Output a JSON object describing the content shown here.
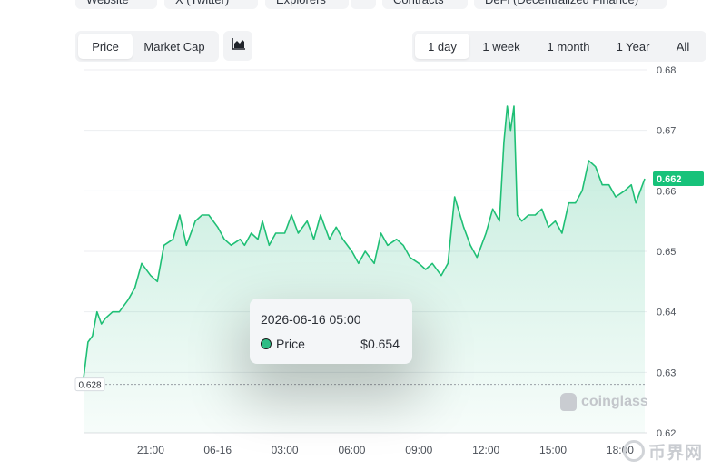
{
  "top_links": [
    "Website",
    "X (Twitter)",
    "Explorers",
    "",
    "Contracts",
    "DeFi (Decentralized Finance)"
  ],
  "metric_tabs": [
    "Price",
    "Market Cap"
  ],
  "active_metric": "Price",
  "range_tabs": [
    "1 day",
    "1 week",
    "1 month",
    "1 Year",
    "All"
  ],
  "active_range": "1 day",
  "chart_icon": "area-chart-icon",
  "colors": {
    "line": "#1fbf75",
    "fill": "#2ebd85",
    "badge": "#17c27a",
    "tooltip_dot": "#2ebd85"
  },
  "tooltip": {
    "date": "2026-06-16 05:00",
    "series": "Price",
    "value": "$0.654"
  },
  "watermark": "coinglass",
  "corner_logo": "币界网",
  "chart_data": {
    "type": "area",
    "series": [
      {
        "name": "Price"
      }
    ],
    "ylim": [
      0.62,
      0.68
    ],
    "y_ticks": [
      "0.68",
      "0.67",
      "0.66",
      "0.65",
      "0.64",
      "0.63",
      "0.62"
    ],
    "x_ticks": [
      "21:00",
      "06-16",
      "03:00",
      "06:00",
      "09:00",
      "12:00",
      "15:00",
      "18:00"
    ],
    "x_tick_hours": [
      3,
      6,
      9,
      12,
      15,
      18,
      21,
      24
    ],
    "hours": [
      0,
      0.2,
      0.4,
      0.6,
      0.8,
      1.0,
      1.3,
      1.6,
      2.0,
      2.3,
      2.6,
      3.0,
      3.3,
      3.6,
      4.0,
      4.3,
      4.6,
      5.0,
      5.3,
      5.6,
      6.0,
      6.3,
      6.6,
      7.0,
      7.2,
      7.5,
      7.8,
      8.0,
      8.3,
      8.6,
      9.0,
      9.3,
      9.6,
      10.0,
      10.3,
      10.6,
      11.0,
      11.3,
      11.6,
      12.0,
      12.3,
      12.6,
      13.0,
      13.3,
      13.6,
      14.0,
      14.3,
      14.6,
      15.0,
      15.3,
      15.6,
      16.0,
      16.3,
      16.6,
      17.0,
      17.3,
      17.6,
      18.0,
      18.3,
      18.6,
      18.8,
      18.95,
      19.1,
      19.25,
      19.4,
      19.6,
      19.9,
      20.2,
      20.5,
      20.8,
      21.1,
      21.4,
      21.7,
      22.0,
      22.3,
      22.6,
      22.9,
      23.2,
      23.5,
      23.8,
      24.2,
      24.5,
      24.7,
      24.9,
      25.1
    ],
    "values": [
      0.629,
      0.635,
      0.636,
      0.64,
      0.638,
      0.639,
      0.64,
      0.64,
      0.642,
      0.644,
      0.648,
      0.646,
      0.645,
      0.651,
      0.652,
      0.656,
      0.651,
      0.655,
      0.656,
      0.656,
      0.654,
      0.652,
      0.651,
      0.652,
      0.651,
      0.653,
      0.652,
      0.655,
      0.651,
      0.653,
      0.653,
      0.656,
      0.653,
      0.655,
      0.652,
      0.656,
      0.652,
      0.654,
      0.652,
      0.65,
      0.648,
      0.65,
      0.648,
      0.653,
      0.651,
      0.652,
      0.651,
      0.649,
      0.648,
      0.647,
      0.648,
      0.646,
      0.648,
      0.659,
      0.654,
      0.651,
      0.649,
      0.653,
      0.657,
      0.655,
      0.668,
      0.674,
      0.67,
      0.674,
      0.656,
      0.655,
      0.656,
      0.656,
      0.657,
      0.654,
      0.655,
      0.653,
      0.658,
      0.658,
      0.66,
      0.665,
      0.664,
      0.661,
      0.661,
      0.659,
      0.66,
      0.661,
      0.658,
      0.66,
      0.662
    ],
    "last_value_label": "0.662",
    "baseline_label": "0.628",
    "baseline_value": 0.628,
    "hover_hour": 8.0,
    "grid": true,
    "legend": "none"
  }
}
